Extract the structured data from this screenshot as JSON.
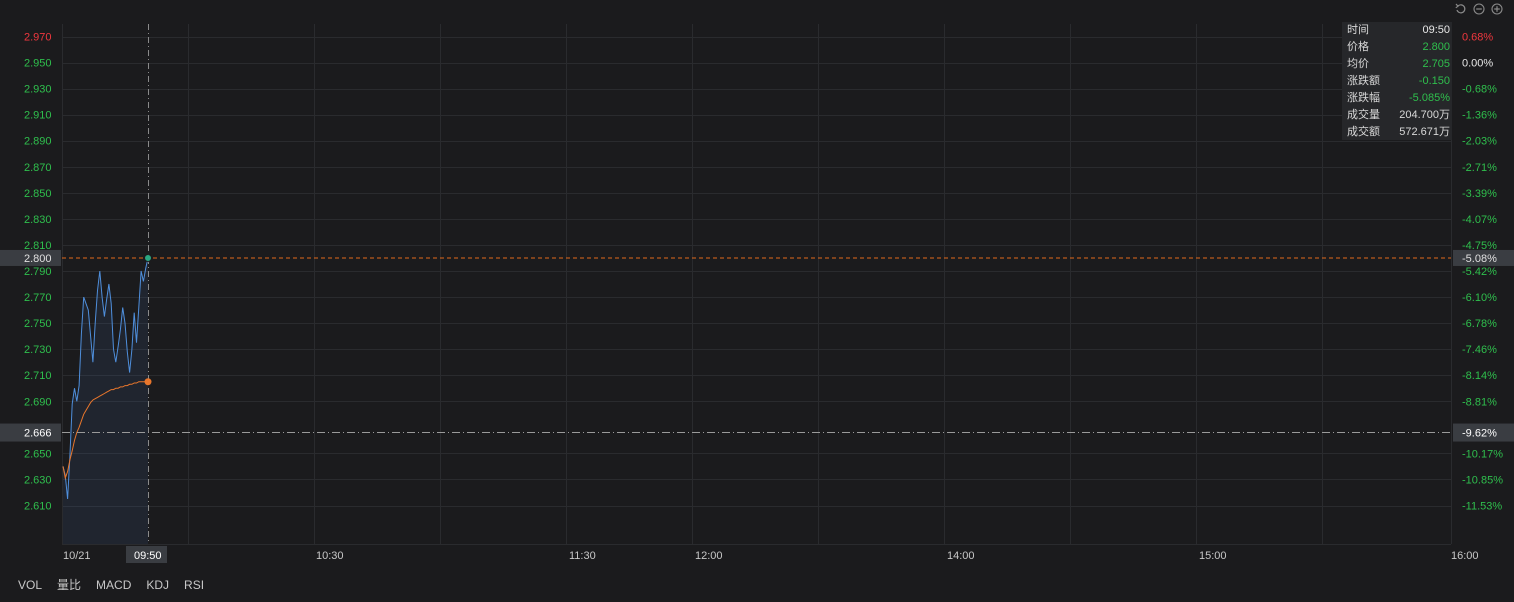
{
  "chart_data": {
    "type": "line",
    "time_axis": [
      "10/21",
      "10:30",
      "11:30",
      "12:00",
      "14:00",
      "15:00",
      "16:00"
    ],
    "crosshair_time": "09:50",
    "price_ticks": [
      "2.970",
      "2.950",
      "2.930",
      "2.910",
      "2.890",
      "2.870",
      "2.850",
      "2.830",
      "2.810",
      "2.790",
      "2.770",
      "2.750",
      "2.730",
      "2.710",
      "2.690",
      "2.650",
      "2.630",
      "2.610"
    ],
    "percent_ticks": [
      "0.68%",
      "0.00%",
      "-0.68%",
      "-1.36%",
      "-2.03%",
      "-2.71%",
      "-3.39%",
      "-4.07%",
      "-4.75%",
      "-5.42%",
      "-6.10%",
      "-6.78%",
      "-7.46%",
      "-8.14%",
      "-8.81%",
      "-10.17%",
      "-10.85%",
      "-11.53%"
    ],
    "ylim": [
      2.59,
      2.98
    ],
    "reference_price": "2.950",
    "cursor_price_label": "2.800",
    "cursor_percent_label": "-5.08%",
    "baseline_price_label": "2.666",
    "baseline_percent_label": "-9.62%",
    "series": [
      {
        "values": [
          2.64,
          2.633,
          2.615,
          2.648,
          2.688,
          2.7,
          2.69,
          2.702,
          2.742,
          2.77,
          2.765,
          2.76,
          2.74,
          2.72,
          2.75,
          2.775,
          2.79,
          2.77,
          2.755,
          2.768,
          2.78,
          2.765,
          2.73,
          2.72,
          2.732,
          2.745,
          2.762,
          2.75,
          2.728,
          2.712,
          2.73,
          2.758,
          2.735,
          2.762,
          2.79,
          2.782,
          2.792,
          2.8
        ]
      },
      {
        "values": [
          2.64,
          2.631,
          2.636,
          2.645,
          2.652,
          2.66,
          2.666,
          2.67,
          2.675,
          2.68,
          2.683,
          2.686,
          2.689,
          2.691,
          2.692,
          2.693,
          2.694,
          2.695,
          2.696,
          2.697,
          2.698,
          2.699,
          2.699,
          2.7,
          2.7,
          2.701,
          2.701,
          2.702,
          2.702,
          2.703,
          2.703,
          2.704,
          2.704,
          2.705,
          2.705,
          2.705,
          2.705,
          2.705
        ]
      }
    ]
  },
  "info_panel": {
    "rows": [
      {
        "label": "时间",
        "value": "09:50"
      },
      {
        "label": "价格",
        "value": "2.800"
      },
      {
        "label": "均价",
        "value": "2.705"
      },
      {
        "label": "涨跌额",
        "value": "-0.150"
      },
      {
        "label": "涨跌幅",
        "value": "-5.085%"
      },
      {
        "label": "成交量",
        "value": "204.700万"
      },
      {
        "label": "成交额",
        "value": "572.671万"
      }
    ],
    "value_colors": [
      "#e8e8e8",
      "#2fbf4d",
      "#2fbf4d",
      "#2fbf4d",
      "#2fbf4d",
      "#d8d8d8",
      "#d8d8d8"
    ]
  },
  "indicator_tabs": [
    "VOL",
    "量比",
    "MACD",
    "KDJ",
    "RSI"
  ],
  "colors": {
    "up": "#f0373e",
    "down": "#2fbf4d",
    "price_line": "#4f8fdc",
    "avg_line": "#e8762c",
    "grid": "#2a2b2e"
  },
  "controls": {
    "reset": "undo-icon",
    "zoom_out": "zoom-out-icon",
    "zoom_in": "zoom-in-icon"
  }
}
